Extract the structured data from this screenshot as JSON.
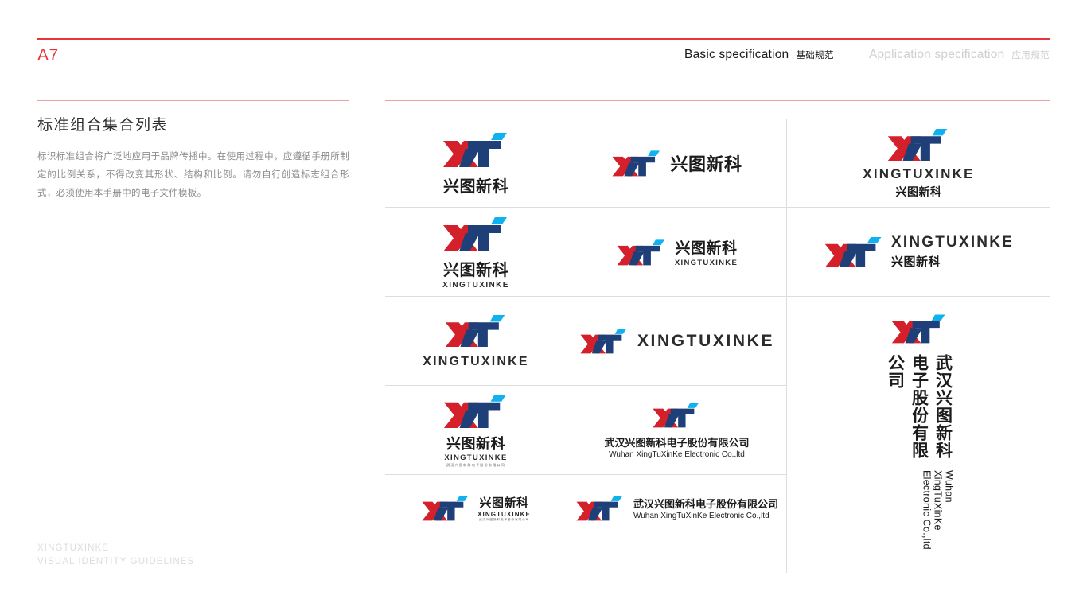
{
  "header": {
    "page_code": "A7",
    "nav": [
      {
        "en": "Basic specification",
        "cn": "基础规范",
        "state": "active"
      },
      {
        "en": "Application specification",
        "cn": "应用规范",
        "state": "inactive"
      }
    ],
    "accent_color": "#e8333a"
  },
  "sidebar": {
    "section_title": "标准组合集合列表",
    "description": "标识标准组合将广泛地应用于品牌传播中。在使用过程中，应遵循手册所制定的比例关系，不得改变其形状、结构和比例。请勿自行创造标志组合形式，必须使用本手册中的电子文件模板。",
    "footer_line1": "XINGTUXINKE",
    "footer_line2": "VISUAL IDENTITY GUIDELINES"
  },
  "brand": {
    "mark_name": "xt-logo-mark",
    "color_red": "#d3202b",
    "color_navy": "#1f3f78",
    "color_cyan": "#0fb2ee",
    "cn_name": "兴图新科",
    "en_name": "XINGTUXINKE",
    "company_cn": "武汉兴图新科电子股份有限公司",
    "company_en": "Wuhan XingTuXinKe Electronic Co.,ltd",
    "micro_cn": "武汉兴图新科电子股份有限公司"
  },
  "grid": {
    "cells": [
      {
        "id": "cell-r1c1",
        "layout": "stacked-cn",
        "label": "兴图新科"
      },
      {
        "id": "cell-r1c2",
        "layout": "horizontal-cn",
        "label": "兴图新科"
      },
      {
        "id": "cell-r1c3",
        "layout": "stacked-en-cn",
        "label": "XINGTUXINKE 兴图新科"
      },
      {
        "id": "cell-r2c1",
        "layout": "stacked-cn-en",
        "label": "兴图新科 XINGTUXINKE"
      },
      {
        "id": "cell-r2c2",
        "layout": "horizontal-cn-en",
        "label": "兴图新科 XINGTUXINKE"
      },
      {
        "id": "cell-r2c3",
        "layout": "horizontal-en-cn",
        "label": "XINGTUXINKE 兴图新科"
      },
      {
        "id": "cell-r3c1",
        "layout": "stacked-en",
        "label": "XINGTUXINKE"
      },
      {
        "id": "cell-r3c2",
        "layout": "horizontal-en",
        "label": "XINGTUXINKE"
      },
      {
        "id": "cell-r4c1",
        "layout": "stacked-cn-en-micro",
        "label": "兴图新科 XINGTUXINKE 武汉兴图新科电子股份有限公司"
      },
      {
        "id": "cell-r4c2",
        "layout": "stacked-company",
        "label": "武汉兴图新科电子股份有限公司 Wuhan XingTuXinKe Electronic Co.,ltd"
      },
      {
        "id": "cell-r5c1",
        "layout": "horizontal-cn-en-micro",
        "label": "兴图新科 XINGTUXINKE 武汉兴图新科电子股份有限公司"
      },
      {
        "id": "cell-r5c2",
        "layout": "horizontal-company",
        "label": "武汉兴图新科电子股份有限公司 Wuhan XingTuXinKe Electronic Co.,ltd"
      },
      {
        "id": "cell-r3c3-vertical",
        "layout": "vertical-company",
        "label": "武汉兴图新科电子股份有限公司 Wuhan XingTuXinKe Electronic Co.,ltd"
      }
    ]
  }
}
